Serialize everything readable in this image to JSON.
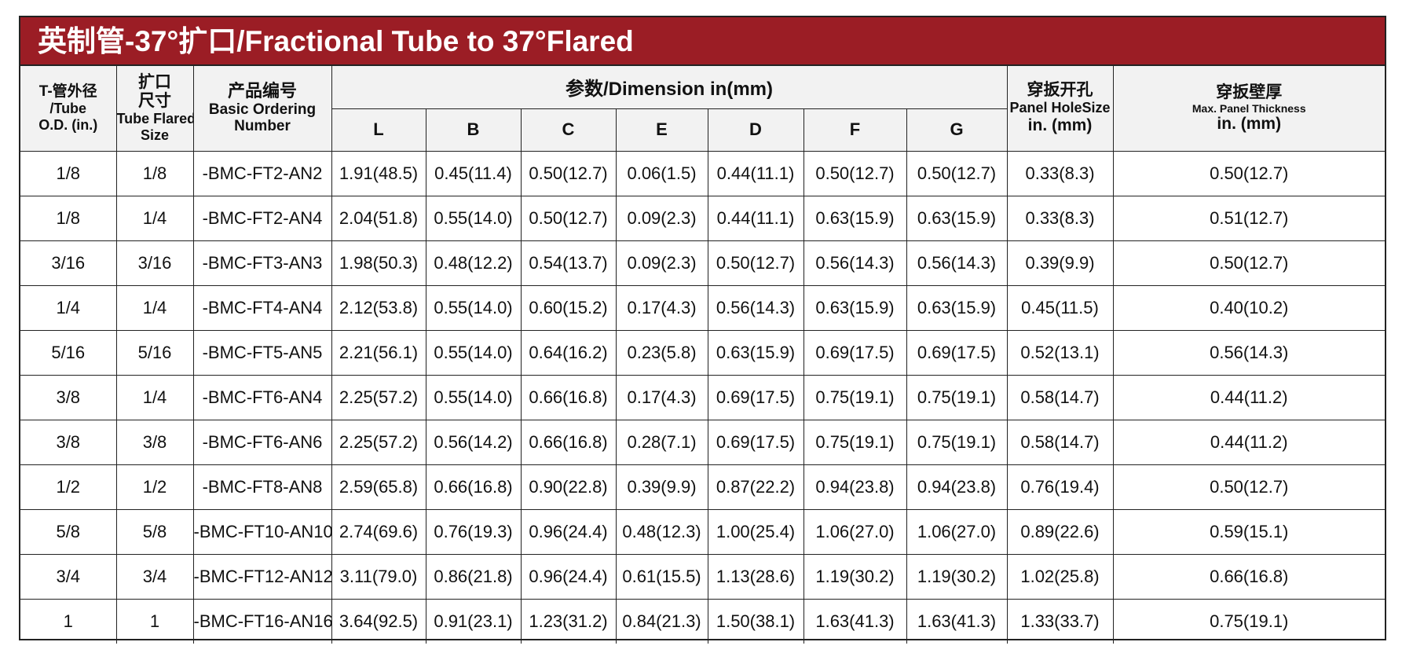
{
  "title": "英制管-37°扩口/Fractional Tube to 37°Flared",
  "header": {
    "tube_od": [
      "T-管外径",
      "/Tube",
      "O.D.  (in.)"
    ],
    "flared_size": [
      "扩口",
      "尺寸",
      "Tube Flared",
      "Size"
    ],
    "ordering": [
      "产品编号",
      "Basic Ordering",
      "Number"
    ],
    "dimension_group": "参数/Dimension  in(mm)",
    "dimension_cols": [
      "L",
      "B",
      "C",
      "E",
      "D",
      "F",
      "G"
    ],
    "panel_hole": [
      "穿扳开孔",
      "Panel HoleSize",
      "in. (mm)"
    ],
    "panel_thickness": [
      "穿扳壁厚",
      "Max. Panel Thickness",
      "in. (mm)"
    ]
  },
  "rows": [
    {
      "od": "1/8",
      "flared": "1/8",
      "ordering": "-BMC-FT2-AN2",
      "L": "1.91(48.5)",
      "B": "0.45(11.4)",
      "C": "0.50(12.7)",
      "E": "0.06(1.5)",
      "D": "0.44(11.1)",
      "F": "0.50(12.7)",
      "G": "0.50(12.7)",
      "hole": "0.33(8.3)",
      "thick": "0.50(12.7)"
    },
    {
      "od": "1/8",
      "flared": "1/4",
      "ordering": "-BMC-FT2-AN4",
      "L": "2.04(51.8)",
      "B": "0.55(14.0)",
      "C": "0.50(12.7)",
      "E": "0.09(2.3)",
      "D": "0.44(11.1)",
      "F": "0.63(15.9)",
      "G": "0.63(15.9)",
      "hole": "0.33(8.3)",
      "thick": "0.51(12.7)"
    },
    {
      "od": "3/16",
      "flared": "3/16",
      "ordering": "-BMC-FT3-AN3",
      "L": "1.98(50.3)",
      "B": "0.48(12.2)",
      "C": "0.54(13.7)",
      "E": "0.09(2.3)",
      "D": "0.50(12.7)",
      "F": "0.56(14.3)",
      "G": "0.56(14.3)",
      "hole": "0.39(9.9)",
      "thick": "0.50(12.7)"
    },
    {
      "od": "1/4",
      "flared": "1/4",
      "ordering": "-BMC-FT4-AN4",
      "L": "2.12(53.8)",
      "B": "0.55(14.0)",
      "C": "0.60(15.2)",
      "E": "0.17(4.3)",
      "D": "0.56(14.3)",
      "F": "0.63(15.9)",
      "G": "0.63(15.9)",
      "hole": "0.45(11.5)",
      "thick": "0.40(10.2)"
    },
    {
      "od": "5/16",
      "flared": "5/16",
      "ordering": "-BMC-FT5-AN5",
      "L": "2.21(56.1)",
      "B": "0.55(14.0)",
      "C": "0.64(16.2)",
      "E": "0.23(5.8)",
      "D": "0.63(15.9)",
      "F": "0.69(17.5)",
      "G": "0.69(17.5)",
      "hole": "0.52(13.1)",
      "thick": "0.56(14.3)"
    },
    {
      "od": "3/8",
      "flared": "1/4",
      "ordering": "-BMC-FT6-AN4",
      "L": "2.25(57.2)",
      "B": "0.55(14.0)",
      "C": "0.66(16.8)",
      "E": "0.17(4.3)",
      "D": "0.69(17.5)",
      "F": "0.75(19.1)",
      "G": "0.75(19.1)",
      "hole": "0.58(14.7)",
      "thick": "0.44(11.2)"
    },
    {
      "od": "3/8",
      "flared": "3/8",
      "ordering": "-BMC-FT6-AN6",
      "L": "2.25(57.2)",
      "B": "0.56(14.2)",
      "C": "0.66(16.8)",
      "E": "0.28(7.1)",
      "D": "0.69(17.5)",
      "F": "0.75(19.1)",
      "G": "0.75(19.1)",
      "hole": "0.58(14.7)",
      "thick": "0.44(11.2)"
    },
    {
      "od": "1/2",
      "flared": "1/2",
      "ordering": "-BMC-FT8-AN8",
      "L": "2.59(65.8)",
      "B": "0.66(16.8)",
      "C": "0.90(22.8)",
      "E": "0.39(9.9)",
      "D": "0.87(22.2)",
      "F": "0.94(23.8)",
      "G": "0.94(23.8)",
      "hole": "0.76(19.4)",
      "thick": "0.50(12.7)"
    },
    {
      "od": "5/8",
      "flared": "5/8",
      "ordering": "-BMC-FT10-AN10",
      "L": "2.74(69.6)",
      "B": "0.76(19.3)",
      "C": "0.96(24.4)",
      "E": "0.48(12.3)",
      "D": "1.00(25.4)",
      "F": "1.06(27.0)",
      "G": "1.06(27.0)",
      "hole": "0.89(22.6)",
      "thick": "0.59(15.1)"
    },
    {
      "od": "3/4",
      "flared": "3/4",
      "ordering": "-BMC-FT12-AN12",
      "L": "3.11(79.0)",
      "B": "0.86(21.8)",
      "C": "0.96(24.4)",
      "E": "0.61(15.5)",
      "D": "1.13(28.6)",
      "F": "1.19(30.2)",
      "G": "1.19(30.2)",
      "hole": "1.02(25.8)",
      "thick": "0.66(16.8)"
    },
    {
      "od": "1",
      "flared": "1",
      "ordering": "-BMC-FT16-AN16",
      "L": "3.64(92.5)",
      "B": "0.91(23.1)",
      "C": "1.23(31.2)",
      "E": "0.84(21.3)",
      "D": "1.50(38.1)",
      "F": "1.63(41.3)",
      "G": "1.63(41.3)",
      "hole": "1.33(33.7)",
      "thick": "0.75(19.1)"
    }
  ],
  "colors": {
    "title_bg": "#9b1d25",
    "header_bg": "#f2f2f2",
    "border": "#222222"
  }
}
